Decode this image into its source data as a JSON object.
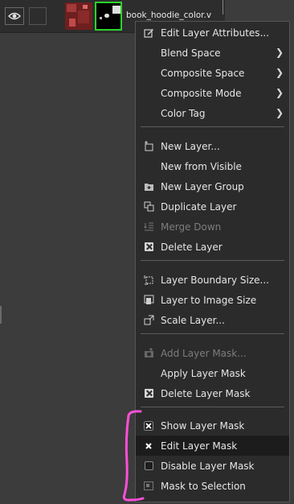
{
  "layer": {
    "name": "book_hoodie_color.v"
  },
  "menu": {
    "items": [
      {
        "label": "Edit Layer Attributes...",
        "icon": "pencil-icon",
        "disabled": false
      },
      {
        "label": "Blend Space",
        "submenu": true,
        "disabled": false
      },
      {
        "label": "Composite Space",
        "submenu": true,
        "disabled": false
      },
      {
        "label": "Composite Mode",
        "submenu": true,
        "disabled": false
      },
      {
        "label": "Color Tag",
        "submenu": true,
        "disabled": false
      },
      {
        "label": "New Layer...",
        "icon": "new-layer-icon",
        "disabled": false
      },
      {
        "label": "New from Visible",
        "disabled": false
      },
      {
        "label": "New Layer Group",
        "icon": "new-group-icon",
        "disabled": false
      },
      {
        "label": "Duplicate Layer",
        "icon": "duplicate-icon",
        "disabled": false
      },
      {
        "label": "Merge Down",
        "icon": "merge-down-icon",
        "disabled": true
      },
      {
        "label": "Delete Layer",
        "icon": "delete-icon",
        "disabled": false
      },
      {
        "label": "Layer Boundary Size...",
        "icon": "boundary-size-icon",
        "disabled": false
      },
      {
        "label": "Layer to Image Size",
        "icon": "layer-to-image-icon",
        "disabled": false
      },
      {
        "label": "Scale Layer...",
        "icon": "scale-icon",
        "disabled": false
      },
      {
        "label": "Add Layer Mask...",
        "icon": "add-mask-icon",
        "disabled": true
      },
      {
        "label": "Apply Layer Mask",
        "disabled": false
      },
      {
        "label": "Delete Layer Mask",
        "icon": "delete-mask-icon",
        "disabled": false
      },
      {
        "label": "Show Layer Mask",
        "icon": "checkbox-checked-icon",
        "disabled": false
      },
      {
        "label": "Edit Layer Mask",
        "icon": "checkbox-checked-icon",
        "disabled": false,
        "active": true
      },
      {
        "label": "Disable Layer Mask",
        "icon": "checkbox-empty-icon",
        "disabled": false
      },
      {
        "label": "Mask to Selection",
        "icon": "mask-selection-icon",
        "disabled": false
      }
    ]
  },
  "colors": {
    "mask_border": "#2ad52a",
    "annotation": "#ff4fd8",
    "menu_bg": "#2b2b2b"
  }
}
